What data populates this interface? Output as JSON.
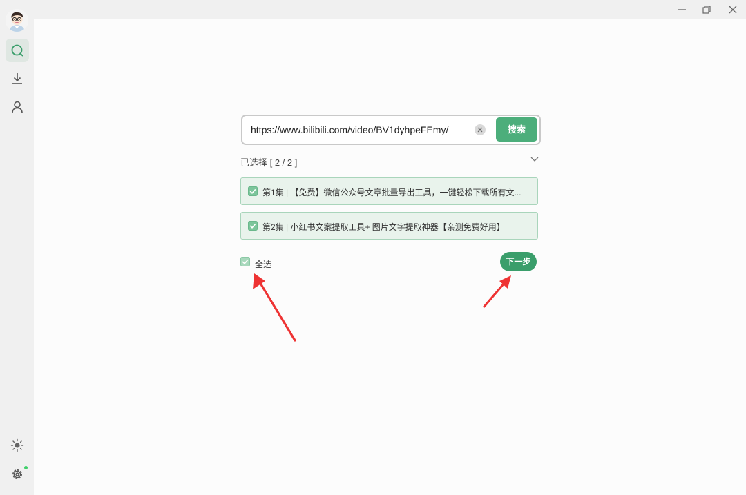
{
  "window": {
    "controls": [
      "minimize",
      "restore",
      "close"
    ]
  },
  "sidebar": {
    "items": [
      {
        "icon": "search-icon",
        "active": true
      },
      {
        "icon": "download-icon",
        "active": false
      },
      {
        "icon": "user-icon",
        "active": false
      }
    ],
    "bottom": [
      {
        "icon": "sun-icon"
      },
      {
        "icon": "gear-icon",
        "badge_color": "#3fcf6a"
      }
    ]
  },
  "search": {
    "url_value": "https://www.bilibili.com/video/BV1dyhpeFEmy/",
    "button_label": "搜索"
  },
  "selection": {
    "summary": "已选择 [ 2 / 2 ]",
    "episodes": [
      {
        "label": "第1集 | 【免费】微信公众号文章批量导出工具，一键轻松下载所有文...",
        "checked": true
      },
      {
        "label": "第2集 | 小红书文案提取工具+ 图片文字提取神器【亲测免费好用】",
        "checked": true
      }
    ],
    "select_all_label": "全选",
    "select_all_checked": true,
    "next_label": "下一步"
  },
  "colors": {
    "accent": "#4cae7b",
    "accent_dark": "#3a9e6b",
    "item_bg": "#e9f3ec",
    "annotation_arrow": "#ee3333"
  }
}
